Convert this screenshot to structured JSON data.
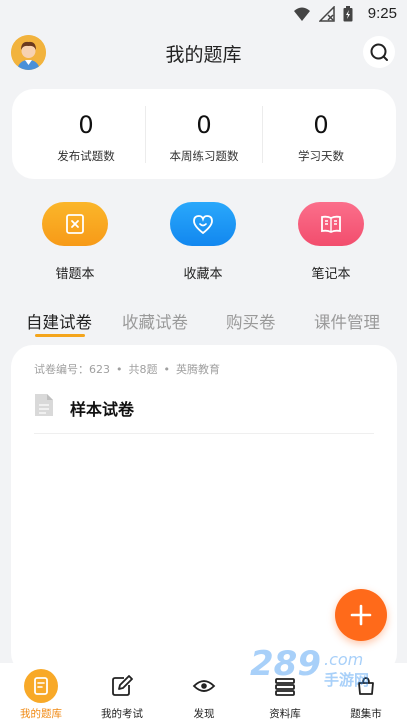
{
  "status_bar": {
    "time": "9:25"
  },
  "header": {
    "title": "我的题库"
  },
  "stats": [
    {
      "value": "0",
      "label": "发布试题数"
    },
    {
      "value": "0",
      "label": "本周练习题数"
    },
    {
      "value": "0",
      "label": "学习天数"
    }
  ],
  "shortcuts": [
    {
      "label": "错题本",
      "color": "#f9a51f"
    },
    {
      "label": "收藏本",
      "color": "#1b9af7"
    },
    {
      "label": "笔记本",
      "color": "#f55c7a"
    }
  ],
  "tabs": [
    {
      "label": "自建试卷",
      "active": true
    },
    {
      "label": "收藏试卷",
      "active": false
    },
    {
      "label": "购买卷",
      "active": false
    },
    {
      "label": "课件管理",
      "active": false
    }
  ],
  "paper": {
    "meta": {
      "code": "试卷编号：623",
      "count": "共8题",
      "org": "英腾教育"
    },
    "name": "样本试卷"
  },
  "fab": {
    "icon": "plus-icon"
  },
  "bottom_nav": [
    {
      "label": "我的题库",
      "icon": "question-bank-icon",
      "active": true
    },
    {
      "label": "我的考试",
      "icon": "exam-edit-icon",
      "active": false
    },
    {
      "label": "发现",
      "icon": "eye-icon",
      "active": false
    },
    {
      "label": "资料库",
      "icon": "library-icon",
      "active": false
    },
    {
      "label": "题集市",
      "icon": "market-icon",
      "active": false
    }
  ],
  "watermark": {
    "text": "289.com 手游网"
  },
  "colors": {
    "accent": "#f4a51c",
    "fab": "#ff6a1a"
  }
}
